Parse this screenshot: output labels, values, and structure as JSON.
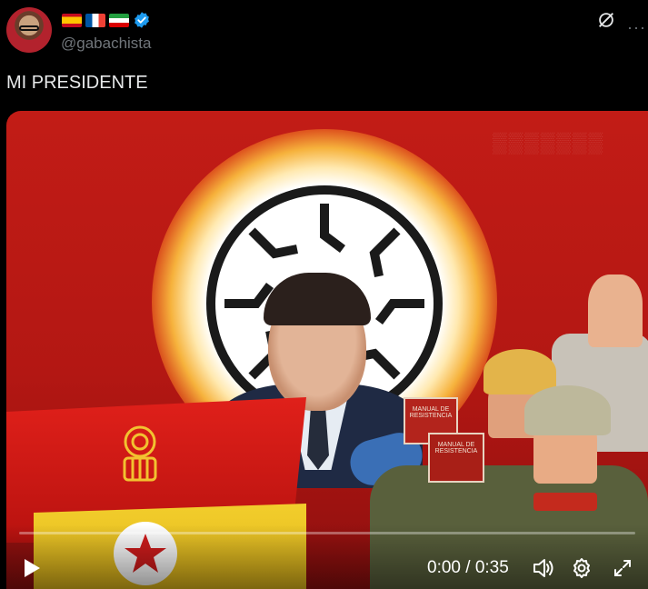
{
  "post": {
    "handle": "@gabachista",
    "flags": [
      "flag-spain",
      "flag-france",
      "flag-iran"
    ],
    "verified_icon": "verified-badge-icon",
    "text": "MI PRESIDENTE"
  },
  "header_icons": {
    "grok": "grok-icon",
    "more": "more-options-icon",
    "more_glyph": "···"
  },
  "video": {
    "book1_text": "MANUAL DE RESISTENCIA",
    "book2_text": "MANUAL DE RESISTENCIA",
    "controls": {
      "time_text": "0:00 / 0:35",
      "progress_fraction": 0.0,
      "play_icon": "play-icon",
      "volume_icon": "volume-icon",
      "settings_icon": "settings-gear-icon",
      "fullscreen_icon": "fullscreen-icon"
    }
  },
  "colors": {
    "background": "#000000",
    "text": "#e7e9ea",
    "secondary_text": "#71767b",
    "accent": "#1d9bf0"
  }
}
